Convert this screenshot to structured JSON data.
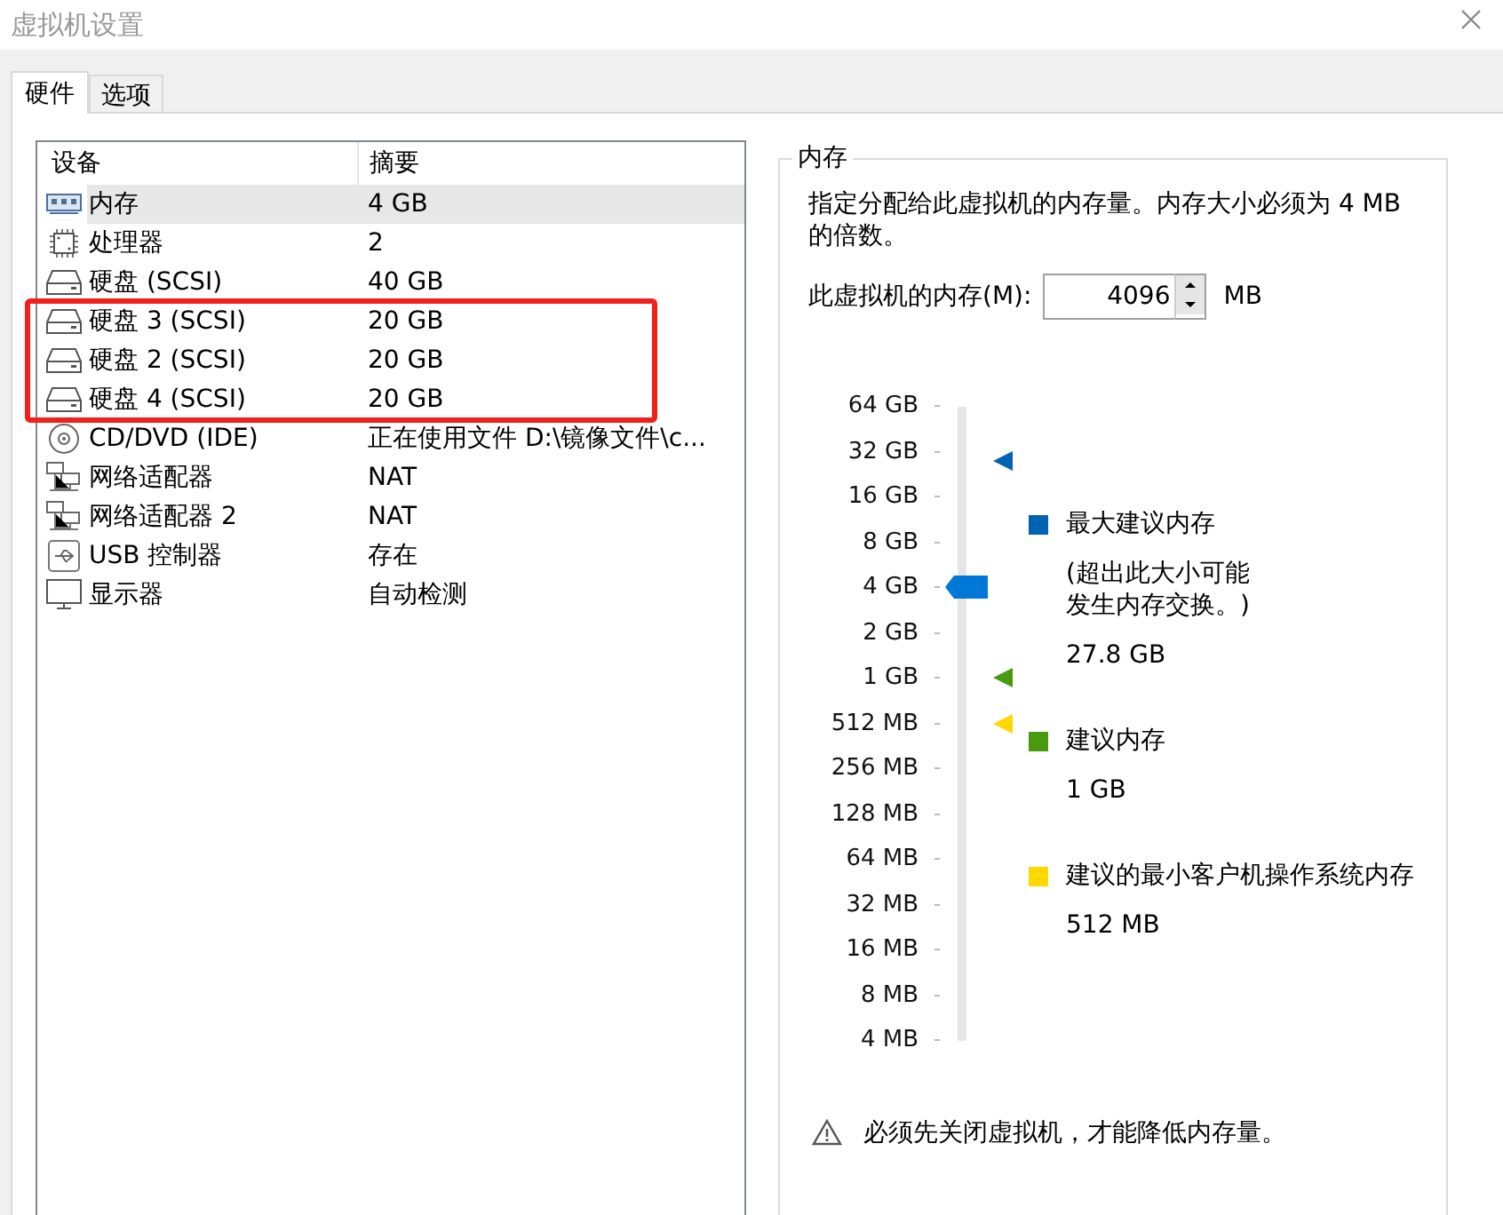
{
  "window": {
    "title": "虚拟机设置"
  },
  "tabs": [
    {
      "label": "硬件",
      "selected": true
    },
    {
      "label": "选项",
      "selected": false
    }
  ],
  "device_table": {
    "columns": [
      "设备",
      "摘要"
    ],
    "rows": [
      {
        "kind": "memory",
        "device": "内存",
        "summary": "4 GB",
        "selected": true,
        "marked": false
      },
      {
        "kind": "cpu",
        "device": "处理器",
        "summary": "2",
        "selected": false,
        "marked": false
      },
      {
        "kind": "disk",
        "device": "硬盘 (SCSI)",
        "summary": "40 GB",
        "selected": false,
        "marked": false
      },
      {
        "kind": "disk",
        "device": "硬盘 3 (SCSI)",
        "summary": "20 GB",
        "selected": false,
        "marked": true
      },
      {
        "kind": "disk",
        "device": "硬盘 2 (SCSI)",
        "summary": "20 GB",
        "selected": false,
        "marked": true
      },
      {
        "kind": "disk",
        "device": "硬盘 4 (SCSI)",
        "summary": "20 GB",
        "selected": false,
        "marked": true
      },
      {
        "kind": "cdrom",
        "device": "CD/DVD (IDE)",
        "summary": "正在使用文件 D:\\镜像文件\\c...",
        "selected": false,
        "marked": false
      },
      {
        "kind": "network",
        "device": "网络适配器",
        "summary": "NAT",
        "selected": false,
        "marked": false
      },
      {
        "kind": "network",
        "device": "网络适配器 2",
        "summary": "NAT",
        "selected": false,
        "marked": false
      },
      {
        "kind": "usb",
        "device": "USB 控制器",
        "summary": "存在",
        "selected": false,
        "marked": false
      },
      {
        "kind": "display",
        "device": "显示器",
        "summary": "自动检测",
        "selected": false,
        "marked": false
      }
    ]
  },
  "memory_panel": {
    "title": "内存",
    "description": "指定分配给此虚拟机的内存量。内存大小必须为 4 MB 的倍数。",
    "field_label": "此虚拟机的内存(M):",
    "value": "4096",
    "unit": "MB",
    "slider": {
      "level": 0.714,
      "markers": [
        {
          "color": "#0063b1",
          "level": 0.914
        },
        {
          "color": "#4a9a0f",
          "level": 0.571
        },
        {
          "color": "#ffd800",
          "level": 0.5
        }
      ],
      "ticks": [
        "64 GB",
        "32 GB",
        "16 GB",
        "8 GB",
        "4 GB",
        "2 GB",
        "1 GB",
        "512 MB",
        "256 MB",
        "128 MB",
        "64 MB",
        "32 MB",
        "16 MB",
        "8 MB",
        "4 MB"
      ]
    },
    "legend": [
      {
        "color": "#0063b1",
        "label": "最大建议内存",
        "note_lines": [
          "(超出此大小可能",
          "发生内存交换。)"
        ],
        "value": "27.8 GB"
      },
      {
        "color": "#4a9a0f",
        "label": "建议内存",
        "value": "1 GB"
      },
      {
        "color": "#ffd800",
        "label": "建议的最小客户机操作系统内存",
        "value": "512 MB"
      }
    ],
    "warning": "必须先关闭虚拟机，才能降低内存量。"
  }
}
